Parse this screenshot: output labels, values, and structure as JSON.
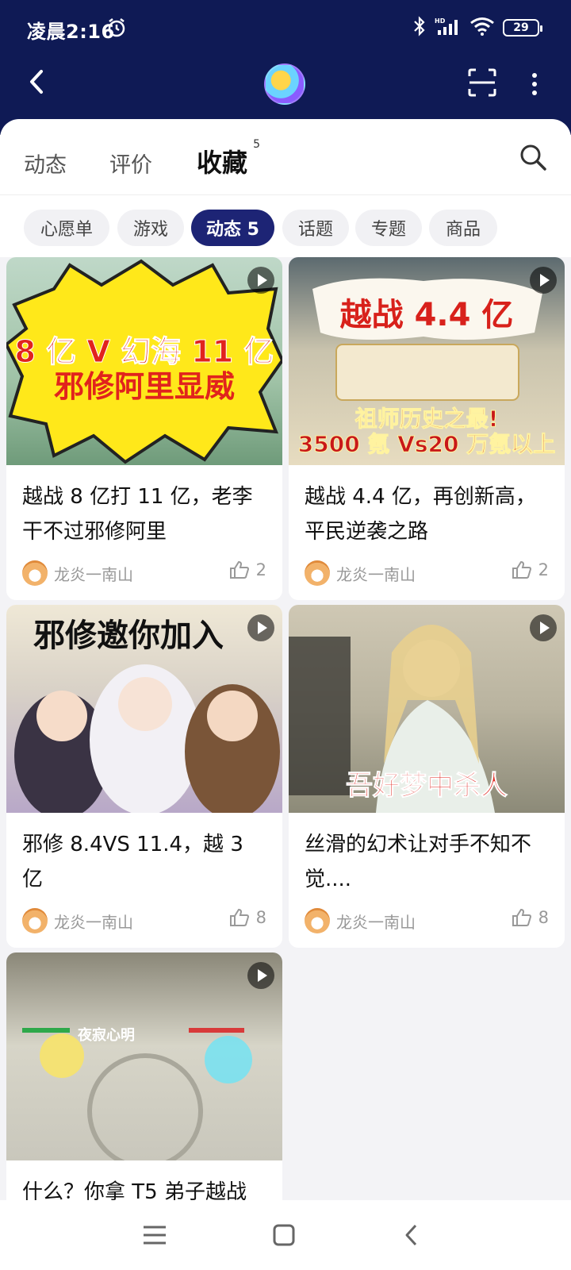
{
  "status_bar": {
    "time": "凌晨2:16",
    "battery": "29"
  },
  "tabs": [
    {
      "label": "动态"
    },
    {
      "label": "评价"
    },
    {
      "label": "收藏",
      "count": "5"
    }
  ],
  "chips": [
    "心愿单",
    "游戏",
    "动态 5",
    "话题",
    "专题",
    "商品"
  ],
  "posts": [
    {
      "thumb_lines": [
        "8 亿 V 幻海 11 亿",
        "邪修阿里显威"
      ],
      "title": "越战 8 亿打 11 亿，老李干不过邪修阿里",
      "author": "龙炎一南山",
      "likes": "2"
    },
    {
      "thumb_lines": [
        "越战 4.4 亿",
        "祖师历史之最!",
        "3500 氪 Vs20 万氪以上"
      ],
      "title": "越战 4.4 亿，再创新高，平民逆袭之路",
      "author": "龙炎一南山",
      "likes": "2"
    },
    {
      "thumb_lines": [
        "邪修邀你加入"
      ],
      "title": "邪修 8.4VS 11.4，越 3 亿",
      "author": "龙炎一南山",
      "likes": "8"
    },
    {
      "thumb_lines": [
        "吾好梦中杀人"
      ],
      "title": "丝滑的幻术让对手不知不觉....",
      "author": "龙炎一南山",
      "likes": "8"
    },
    {
      "thumb_lines": [
        "夜寂心明"
      ],
      "title": "什么？你拿 T5 弟子越战",
      "author": "",
      "likes": ""
    }
  ]
}
